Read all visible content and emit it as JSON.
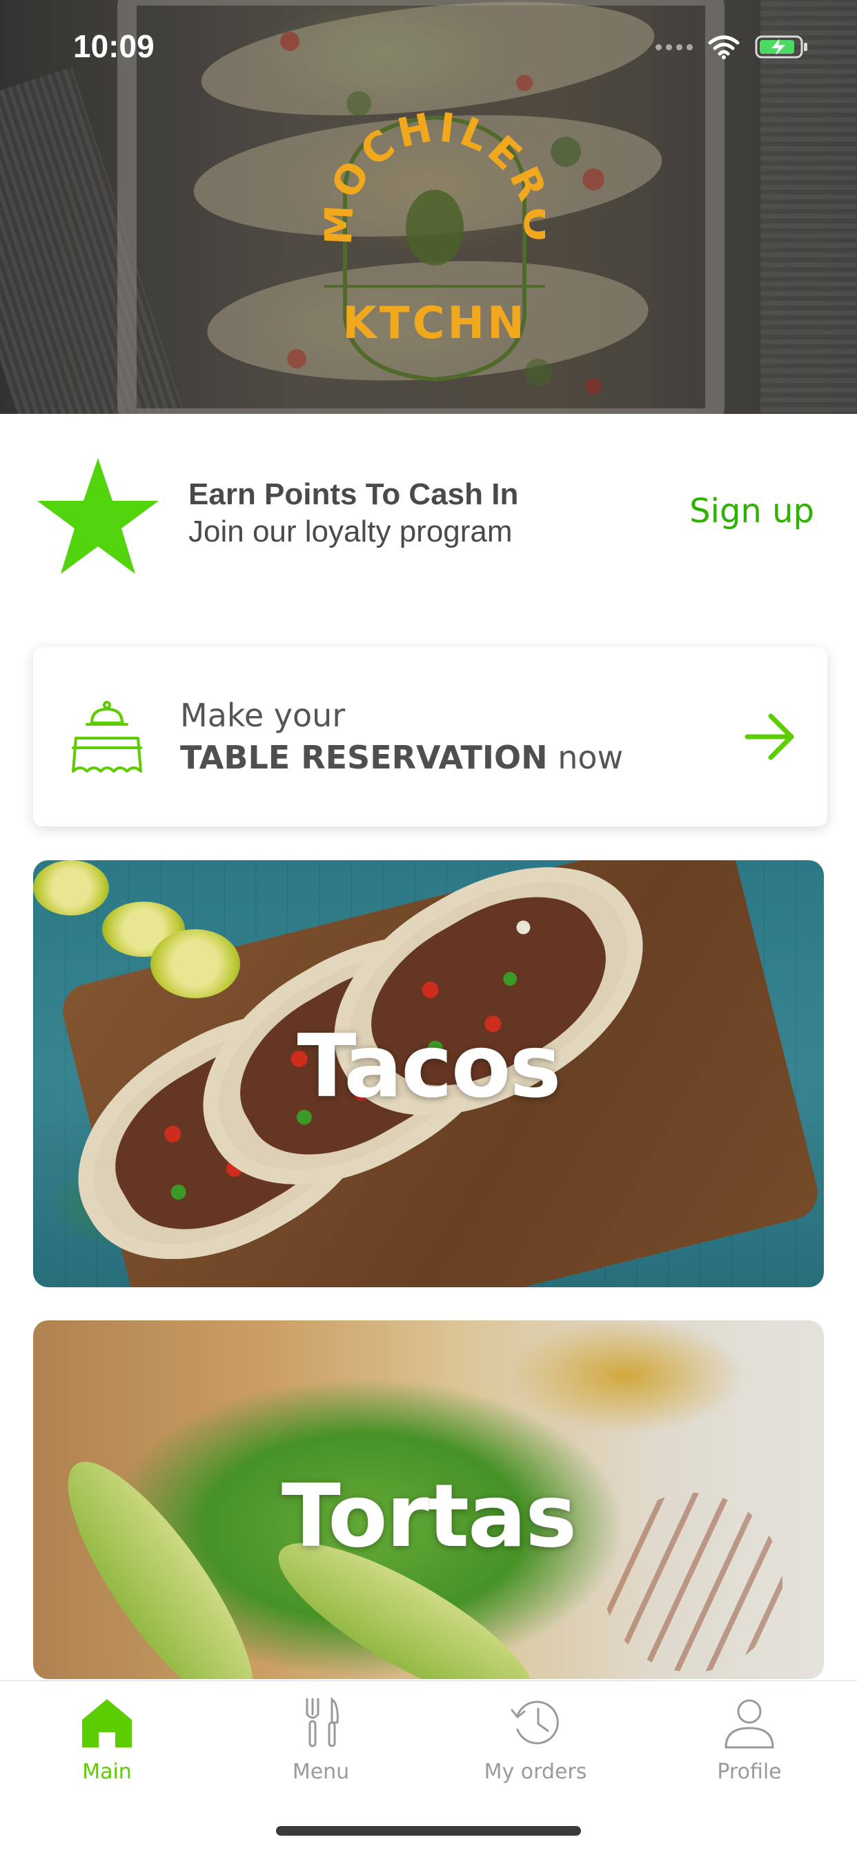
{
  "status_bar": {
    "time": "10:09"
  },
  "brand": {
    "logo_top": "MOCHILERO",
    "logo_bottom": "KTCHN",
    "logo_color": "#f2a81d"
  },
  "loyalty": {
    "title": "Earn Points To Cash In",
    "subtitle": "Join our loyalty program",
    "signup_label": "Sign up",
    "icon": "star-icon"
  },
  "reservation": {
    "line1": "Make your",
    "line2_bold": "TABLE RESERVATION",
    "line2_rest": " now",
    "icon": "table-icon",
    "action_icon": "arrow-right-icon"
  },
  "categories": [
    {
      "label": "Tacos"
    },
    {
      "label": "Tortas"
    }
  ],
  "tabbar": {
    "items": [
      {
        "label": "Main",
        "icon": "home-icon",
        "active": true
      },
      {
        "label": "Menu",
        "icon": "cutlery-icon",
        "active": false
      },
      {
        "label": "My orders",
        "icon": "history-icon",
        "active": false
      },
      {
        "label": "Profile",
        "icon": "user-icon",
        "active": false
      }
    ]
  },
  "colors": {
    "accent": "#5ccd00",
    "signup": "#2db200",
    "text": "#4a4a4a",
    "inactive": "#9a9a9a"
  }
}
